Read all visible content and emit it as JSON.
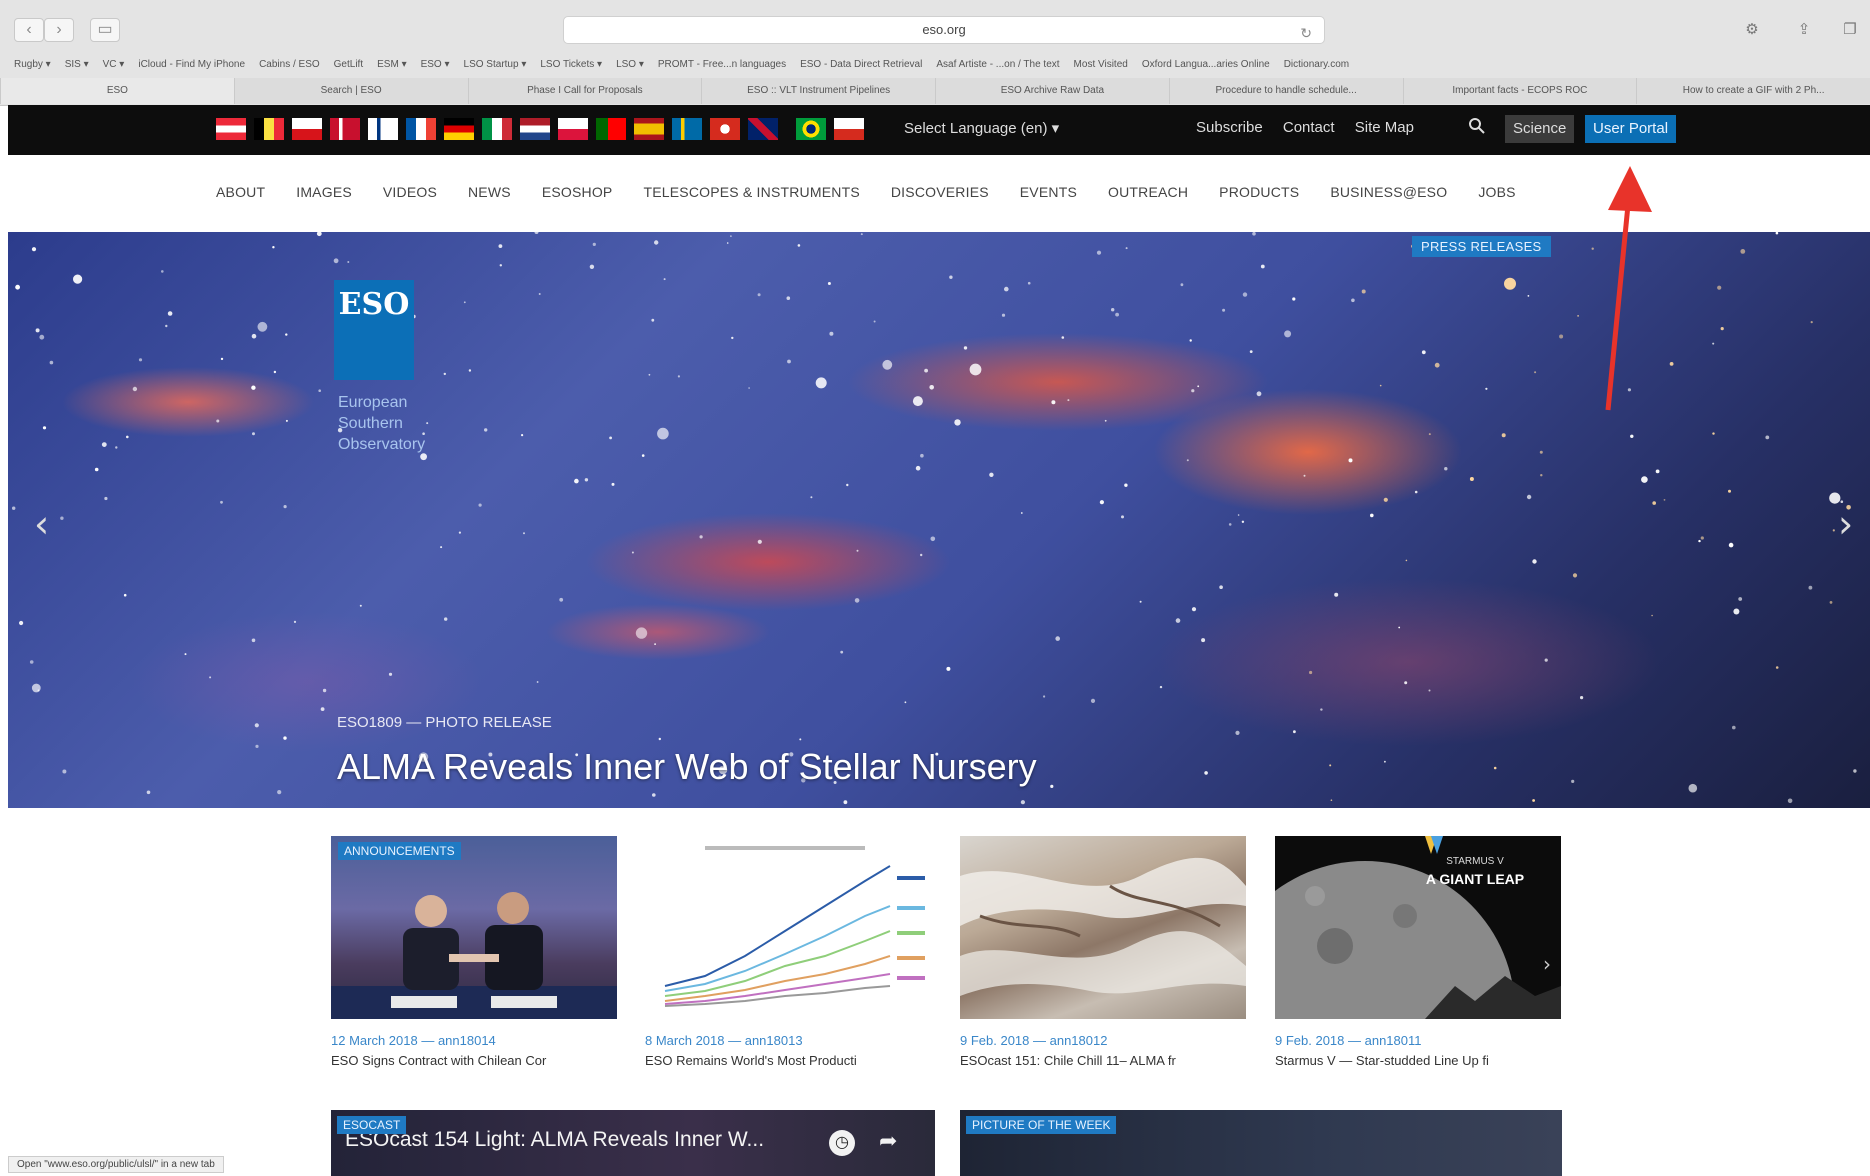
{
  "browser": {
    "address": "eso.org",
    "bookmarks": [
      "Rugby ▾",
      "SIS ▾",
      "VC ▾",
      "iCloud - Find My iPhone",
      "Cabins / ESO",
      "GetLift",
      "ESM ▾",
      "ESO ▾",
      "LSO Startup ▾",
      "LSO Tickets ▾",
      "LSO ▾",
      "PROMT - Free...n languages",
      "ESO - Data Direct Retrieval",
      "Asaf Artiste - ...on / The text",
      "Most Visited",
      "Oxford Langua...aries Online",
      "Dictionary.com"
    ],
    "tabs": [
      "ESO",
      "Search | ESO",
      "Phase I Call for Proposals",
      "ESO :: VLT Instrument Pipelines",
      "ESO Archive Raw Data",
      "Procedure to handle schedule...",
      "Important facts - ECOPS ROC",
      "How to create a GIF with 2 Ph..."
    ],
    "status": "Open \"www.eso.org/public/ulsl/\" in a new tab"
  },
  "topbar": {
    "flags": [
      "austria",
      "belgium",
      "czech",
      "denmark",
      "finland",
      "france",
      "germany",
      "italy",
      "netherlands",
      "poland",
      "portugal",
      "spain",
      "sweden",
      "switzerland",
      "uk",
      "brazil",
      "chile"
    ],
    "language": "Select Language (en) ▾",
    "links": [
      "Subscribe",
      "Contact",
      "Site Map"
    ],
    "science": "Science",
    "user_portal": "User Portal"
  },
  "nav": [
    "ABOUT",
    "IMAGES",
    "VIDEOS",
    "NEWS",
    "ESOSHOP",
    "TELESCOPES & INSTRUMENTS",
    "DISCOVERIES",
    "EVENTS",
    "OUTREACH",
    "PRODUCTS",
    "BUSINESS@ESO",
    "JOBS"
  ],
  "hero": {
    "badge": "PRESS RELEASES",
    "logo_text": "ESO",
    "org_name": [
      "European",
      "Southern",
      "Observatory"
    ],
    "kicker": "ESO1809 — PHOTO RELEASE",
    "title": "ALMA Reveals Inner Web of Stellar Nursery",
    "prev": "‹",
    "next": "›"
  },
  "cards": [
    {
      "badge": "ANNOUNCEMENTS",
      "meta": "12 March 2018 — ann18014",
      "title": "ESO Signs Contract with Chilean Cor"
    },
    {
      "badge": "",
      "meta": "8 March 2018 — ann18013",
      "title": "ESO Remains World's Most Producti"
    },
    {
      "badge": "",
      "meta": "9 Feb. 2018 — ann18012",
      "title": "ESOcast 151: Chile Chill 11– ALMA fr"
    },
    {
      "badge": "",
      "meta": "9 Feb. 2018 — ann18011",
      "title": "Starmus V — Star-studded Line Up fi",
      "thumb_text": [
        "STARMUS V",
        "A GIANT LEAP"
      ]
    }
  ],
  "panels": {
    "video": {
      "badge": "ESOCAST",
      "title": "ESOcast 154 Light: ALMA Reveals Inner W..."
    },
    "potw": {
      "badge": "PICTURE OF THE WEEK"
    }
  },
  "colors": {
    "accent": "#1f7ac3",
    "portal": "#0b6fb5",
    "annotation": "#e8332a"
  }
}
